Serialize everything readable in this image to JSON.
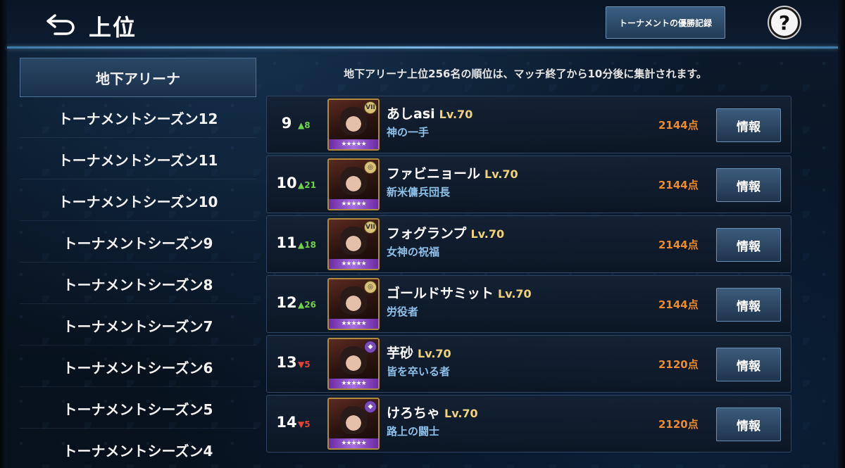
{
  "header": {
    "title": "上位",
    "history_button": "トーナメントの優勝記録",
    "help_icon": "?"
  },
  "sidebar": {
    "items": [
      {
        "label": "地下アリーナ",
        "active": true
      },
      {
        "label": "トーナメントシーズン12",
        "active": false
      },
      {
        "label": "トーナメントシーズン11",
        "active": false
      },
      {
        "label": "トーナメントシーズン10",
        "active": false
      },
      {
        "label": "トーナメントシーズン9",
        "active": false
      },
      {
        "label": "トーナメントシーズン8",
        "active": false
      },
      {
        "label": "トーナメントシーズン7",
        "active": false
      },
      {
        "label": "トーナメントシーズン6",
        "active": false
      },
      {
        "label": "トーナメントシーズン5",
        "active": false
      },
      {
        "label": "トーナメントシーズン4",
        "active": false
      }
    ]
  },
  "notice": "地下アリーナ上位256名の順位は、マッチ終了から10分後に集計されます。",
  "rankings": [
    {
      "rank": "9",
      "delta": "▲8",
      "delta_dir": "up",
      "name": "あしasi",
      "level": "Lv.70",
      "title": "神の一手",
      "points": "2144点",
      "info": "情報",
      "stars": "★★★★★",
      "badge": "VII",
      "badge_color": "gold"
    },
    {
      "rank": "10",
      "delta": "▲21",
      "delta_dir": "up",
      "name": "ファビニョール",
      "level": "Lv.70",
      "title": "新米傭兵団長",
      "points": "2144点",
      "info": "情報",
      "stars": "★★★★★",
      "badge": "◎",
      "badge_color": "gold"
    },
    {
      "rank": "11",
      "delta": "▲18",
      "delta_dir": "up",
      "name": "フォグランプ",
      "level": "Lv.70",
      "title": "女神の祝福",
      "points": "2144点",
      "info": "情報",
      "stars": "★★★★★",
      "badge": "VII",
      "badge_color": "gold"
    },
    {
      "rank": "12",
      "delta": "▲26",
      "delta_dir": "up",
      "name": "ゴールドサミット",
      "level": "Lv.70",
      "title": "労役者",
      "points": "2144点",
      "info": "情報",
      "stars": "★★★★★",
      "badge": "◎",
      "badge_color": "gold"
    },
    {
      "rank": "13",
      "delta": "▼5",
      "delta_dir": "down",
      "name": "芋砂",
      "level": "Lv.70",
      "title": "皆を卒いる者",
      "points": "2120点",
      "info": "情報",
      "stars": "★★★★★",
      "badge": "◆",
      "badge_color": "purple"
    },
    {
      "rank": "14",
      "delta": "▼5",
      "delta_dir": "down",
      "name": "けろちゃ",
      "level": "Lv.70",
      "title": "路上の闘士",
      "points": "2120点",
      "info": "情報",
      "stars": "★★★★★",
      "badge": "◆",
      "badge_color": "purple"
    }
  ]
}
